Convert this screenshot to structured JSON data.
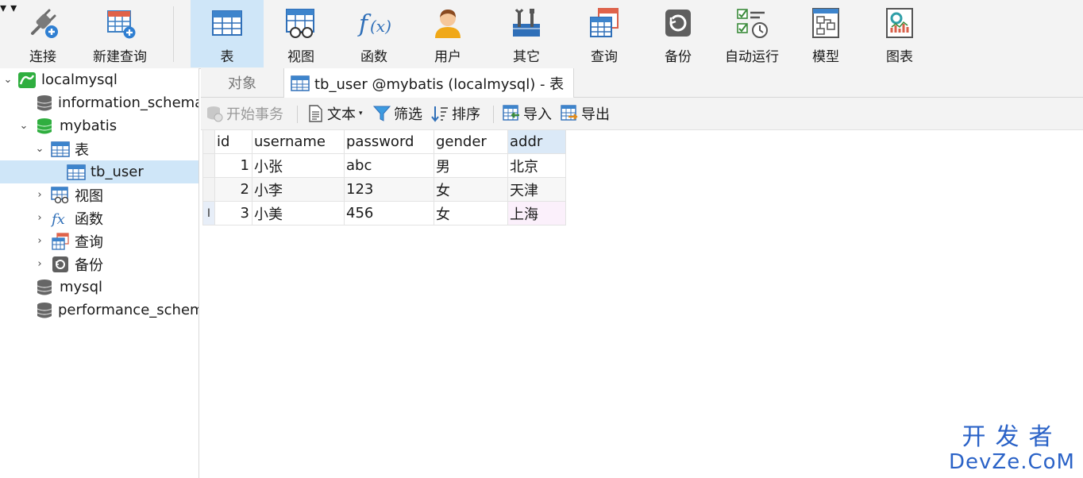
{
  "toolbar": {
    "connect": "连接",
    "new_query": "新建查询",
    "table": "表",
    "view": "视图",
    "function": "函数",
    "user": "用户",
    "other": "其它",
    "query": "查询",
    "backup": "备份",
    "auto_run": "自动运行",
    "model": "模型",
    "chart": "图表"
  },
  "sidebar": {
    "connection": "localmysql",
    "db_information_schema": "information_schema",
    "db_mybatis": "mybatis",
    "tables": "表",
    "table_tb_user": "tb_user",
    "views": "视图",
    "functions": "函数",
    "queries": "查询",
    "backups": "备份",
    "db_mysql": "mysql",
    "db_performance_schema": "performance_schema"
  },
  "tabs": {
    "objects": "对象",
    "active": "tb_user @mybatis (localmysql) - 表"
  },
  "subtoolbar": {
    "begin_transaction": "开始事务",
    "text": "文本",
    "filter": "筛选",
    "sort": "排序",
    "import": "导入",
    "export": "导出"
  },
  "grid": {
    "columns": [
      "id",
      "username",
      "password",
      "gender",
      "addr"
    ],
    "rows": [
      [
        "1",
        "小张",
        "abc",
        "男",
        "北京"
      ],
      [
        "2",
        "小李",
        "123",
        "女",
        "天津"
      ],
      [
        "3",
        "小美",
        "456",
        "女",
        "上海"
      ]
    ],
    "row_marker": "I"
  },
  "watermark": {
    "cn": "开发者",
    "en": "DevZe.CoM"
  },
  "colors": {
    "accent_selection": "#cfe6f8",
    "watermark": "#2a62c7"
  }
}
